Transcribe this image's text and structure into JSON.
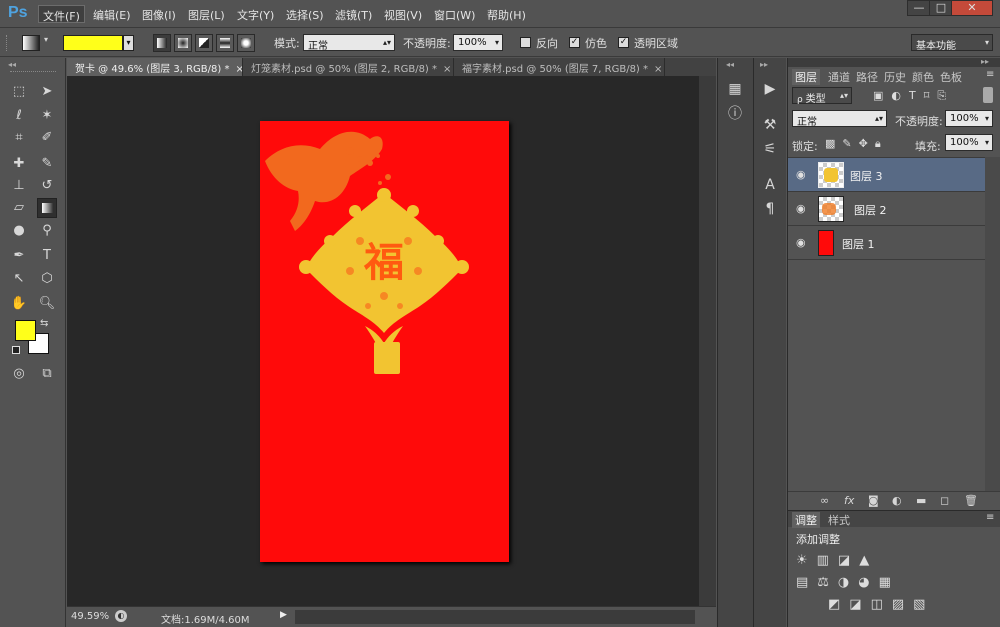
{
  "app": {
    "logo": "Ps"
  },
  "menu": [
    "文件(F)",
    "编辑(E)",
    "图像(I)",
    "图层(L)",
    "文字(Y)",
    "选择(S)",
    "滤镜(T)",
    "视图(V)",
    "窗口(W)",
    "帮助(H)"
  ],
  "window_controls": {
    "minimize": "—",
    "maximize": "□",
    "close": "✕"
  },
  "options": {
    "foreground_swatch": "#ffff1a",
    "mode_label": "模式:",
    "mode_value": "正常",
    "opacity_label": "不透明度:",
    "opacity_value": "100%",
    "reverse_label": "反向",
    "dither_label": "仿色",
    "transparency_label": "透明区域",
    "workspace": "基本功能"
  },
  "tabs": [
    {
      "label": "贺卡 @ 49.6% (图层 3, RGB/8) *"
    },
    {
      "label": "灯笼素材.psd @ 50% (图层 2, RGB/8) *"
    },
    {
      "label": "福字素材.psd @ 50% (图层 7, RGB/8) *"
    }
  ],
  "canvas": {
    "fu_char": "福",
    "background_color": "#ff0a0a",
    "art_color": "#f2c431"
  },
  "status": {
    "zoom": "49.59%",
    "doc_info": "文档:1.69M/4.60M"
  },
  "layers_panel": {
    "tabs": [
      "图层",
      "通道",
      "路径",
      "历史",
      "颜色",
      "色板"
    ],
    "filter_label": "类型",
    "blend_mode": "正常",
    "opacity_label": "不透明度:",
    "opacity_value": "100%",
    "lock_label": "锁定:",
    "fill_label": "填充:",
    "fill_value": "100%",
    "layers": [
      {
        "name": "图层 3",
        "selected": true
      },
      {
        "name": "图层 2",
        "selected": false
      },
      {
        "name": "图层 1",
        "selected": false
      }
    ],
    "footer_icons": [
      "link-icon",
      "fx-icon",
      "mask-icon",
      "adjustment-icon",
      "group-icon",
      "new-layer-icon",
      "trash-icon"
    ]
  },
  "adjust_panel": {
    "tabs": [
      "调整",
      "样式"
    ],
    "title": "添加调整"
  },
  "colors": {
    "foreground": "#ffff1a",
    "background": "#ffffff",
    "selection": "#586a85"
  }
}
